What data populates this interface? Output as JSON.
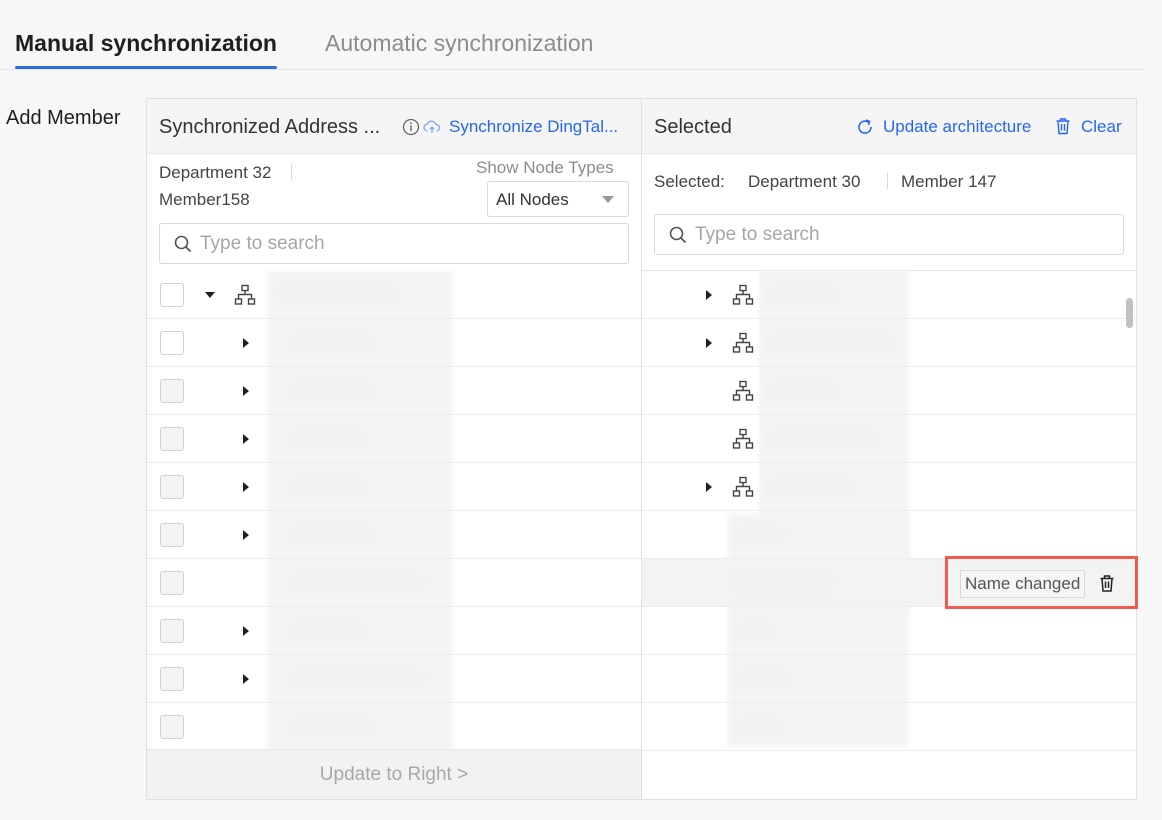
{
  "tabs": [
    {
      "label": "Manual synchronization",
      "active": true
    },
    {
      "label": "Automatic synchronization",
      "active": false
    }
  ],
  "add_member_label": "Add Member",
  "left_panel": {
    "title": "Synchronized Address ...",
    "sync_link": "Synchronize DingTal...",
    "department_stat": "Department 32",
    "member_stat": "Member158",
    "node_types_label": "Show Node Types",
    "node_type_selected": "All Nodes",
    "search_placeholder": "Type to search",
    "footer_button": "Update to Right >"
  },
  "right_panel": {
    "title": "Selected",
    "update_link": "Update architecture",
    "clear_link": "Clear",
    "selected_label": "Selected:",
    "department_stat": "Department 30",
    "member_stat": "Member 147",
    "search_placeholder": "Type to search",
    "tag_name_changed": "Name changed"
  },
  "colors": {
    "accent": "#2468f2",
    "highlight": "#f05a4f",
    "tab_underline": "#2f6fe0"
  }
}
